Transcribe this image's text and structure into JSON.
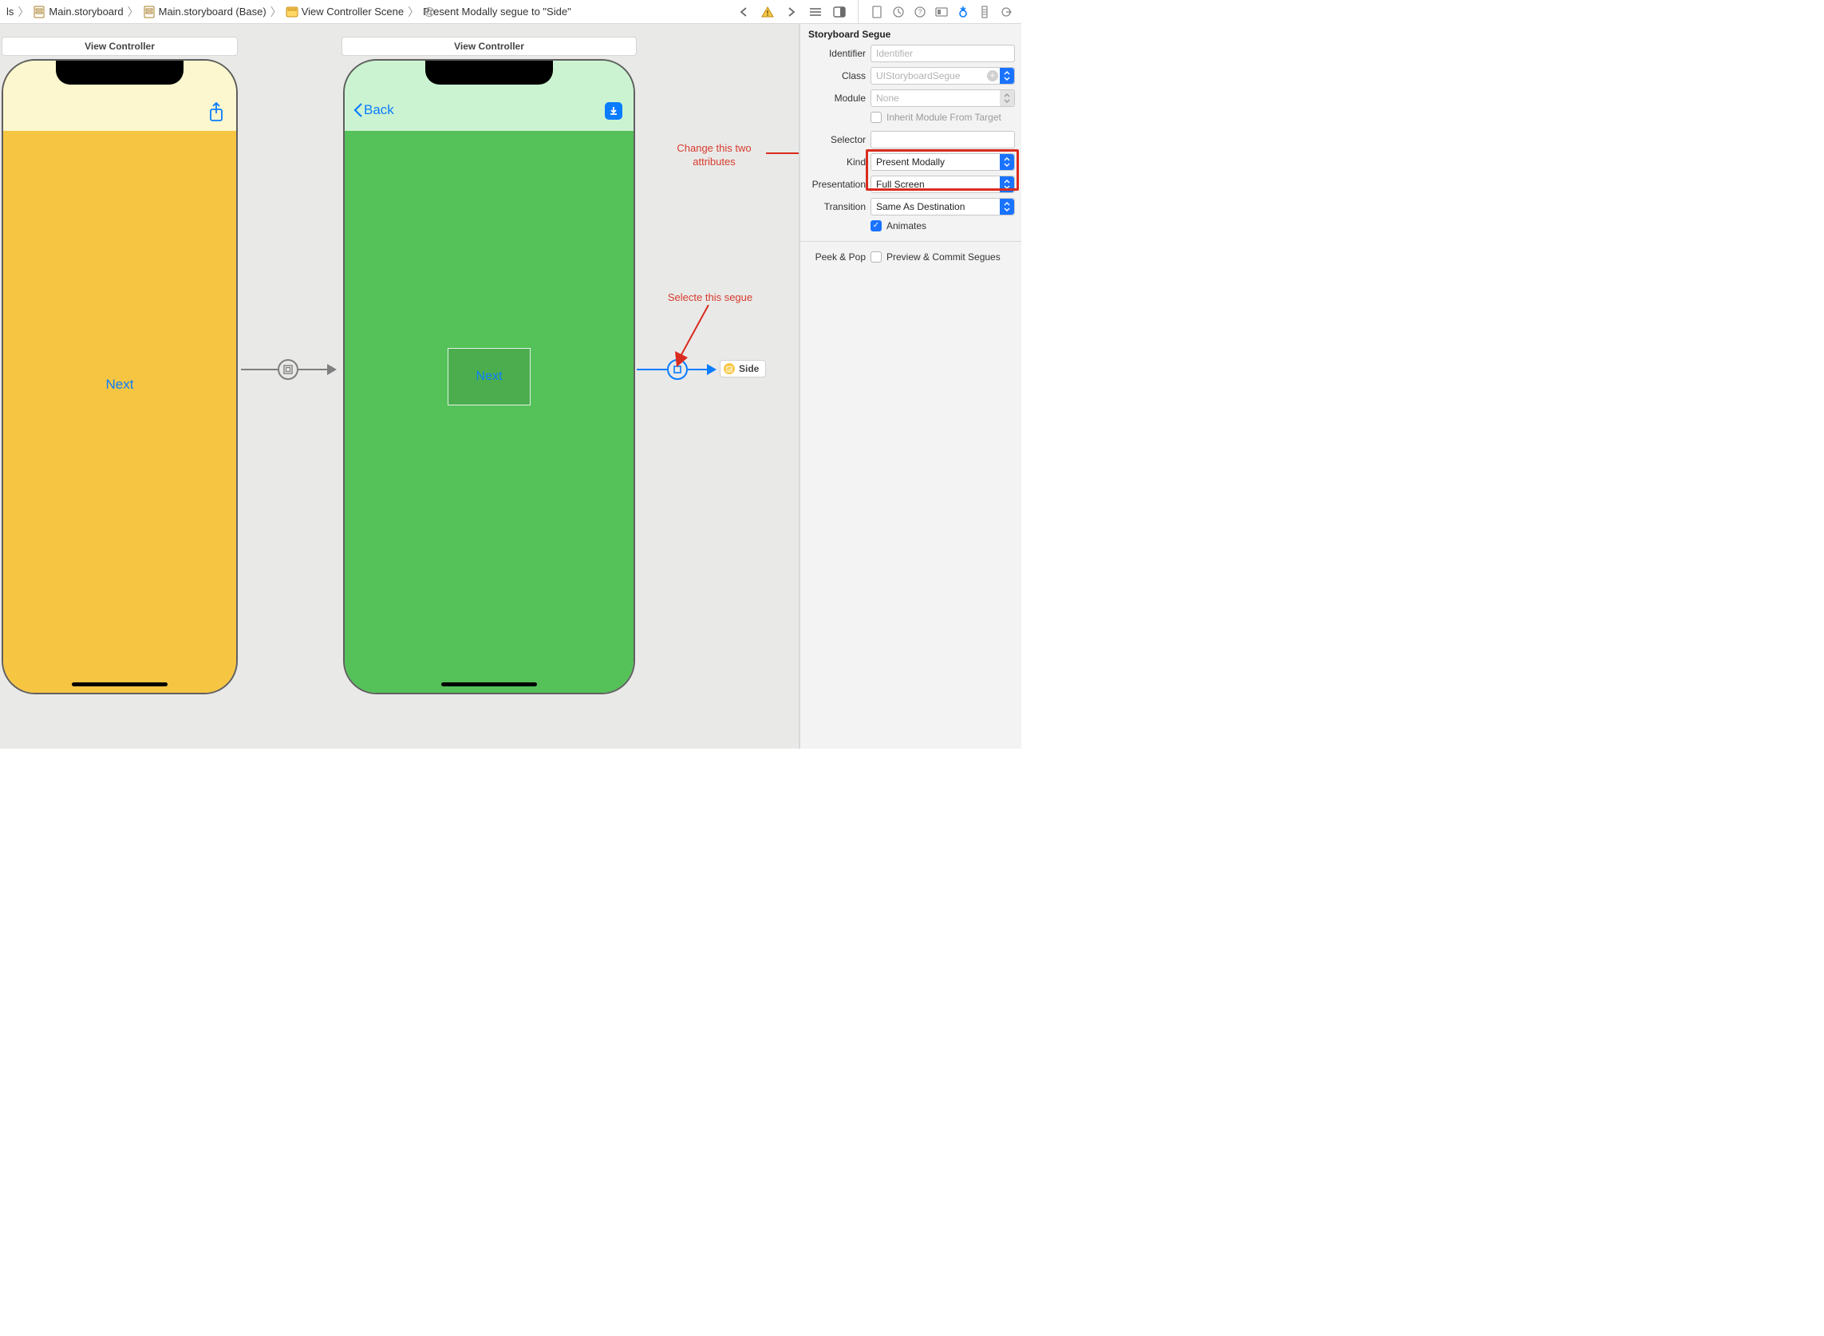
{
  "breadcrumb": {
    "items": [
      {
        "label": "ls"
      },
      {
        "label": "Main.storyboard"
      },
      {
        "label": "Main.storyboard (Base)"
      },
      {
        "label": "View Controller Scene"
      },
      {
        "label": "Present Modally segue to \"Side\""
      }
    ]
  },
  "canvas": {
    "vc1_title": "View Controller",
    "vc2_title": "View Controller",
    "p1_next": "Next",
    "p2_back": "Back",
    "p2_next": "Next",
    "side_label": "Side"
  },
  "annotations": {
    "change_attrs": "Change this two\nattributes",
    "select_segue": "Selecte this segue"
  },
  "inspector": {
    "section_title": "Storyboard Segue",
    "rows": {
      "identifier_label": "Identifier",
      "identifier_placeholder": "Identifier",
      "identifier_value": "",
      "class_label": "Class",
      "class_value": "UIStoryboardSegue",
      "module_label": "Module",
      "module_value": "None",
      "inherit_label": "Inherit Module From Target",
      "selector_label": "Selector",
      "selector_value": "",
      "kind_label": "Kind",
      "kind_value": "Present Modally",
      "presentation_label": "Presentation",
      "presentation_value": "Full Screen",
      "transition_label": "Transition",
      "transition_value": "Same As Destination",
      "animates_label": "Animates",
      "peekpop_label": "Peek & Pop",
      "peekpop_value": "Preview & Commit Segues"
    }
  }
}
